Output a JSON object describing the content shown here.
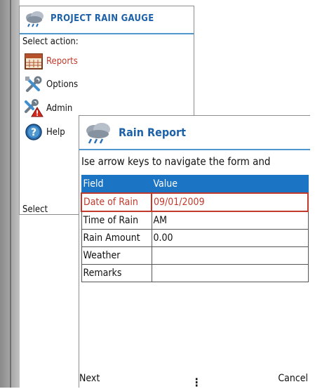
{
  "menu_window": {
    "title": "PROJECT RAIN GAUGE",
    "prompt": "Select action:",
    "items": [
      {
        "label": "Reports",
        "icon": "calendar-icon",
        "selected": true
      },
      {
        "label": "Options",
        "icon": "tools-icon",
        "selected": false
      },
      {
        "label": "Admin",
        "icon": "admin-warning-icon",
        "selected": false
      },
      {
        "label": "Help",
        "icon": "help-icon",
        "selected": false
      }
    ],
    "softkey_left": "Select"
  },
  "report_window": {
    "title": "Rain Report",
    "instruction": "Ise arrow keys to navigate the form and",
    "table": {
      "headers": [
        "Field",
        "Value"
      ],
      "rows": [
        {
          "field": "Date of Rain",
          "value": "09/01/2009",
          "selected": true
        },
        {
          "field": "Time of Rain",
          "value": "AM",
          "selected": false
        },
        {
          "field": "Rain Amount",
          "value": "0.00",
          "selected": false
        },
        {
          "field": "Weather",
          "value": "",
          "selected": false
        },
        {
          "field": "Remarks",
          "value": "",
          "selected": false
        }
      ]
    },
    "softkey_left": "Next",
    "softkey_center": "⋮",
    "softkey_right": "Cancel"
  },
  "colors": {
    "accent": "#1d62a8",
    "header_bg": "#1c74c4",
    "selection": "#c0392b",
    "divider": "#4f97cf"
  }
}
